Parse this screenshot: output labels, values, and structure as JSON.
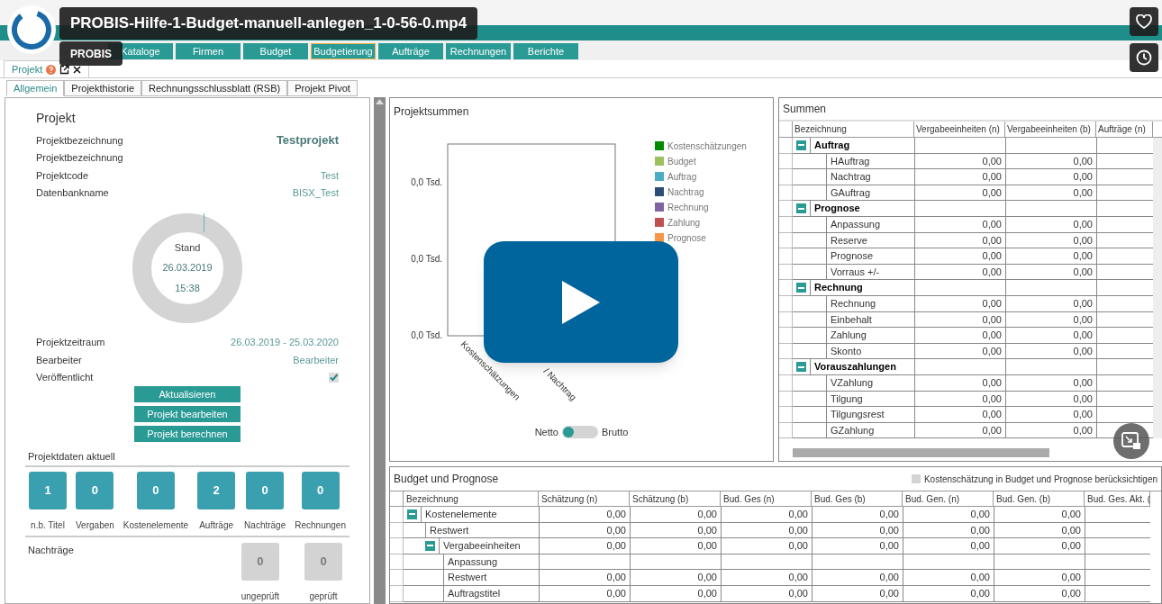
{
  "video": {
    "title": "PROBIS-Hilfe-1-Budget-manuell-anlegen_1-0-56-0.mp4",
    "channel": "PROBIS"
  },
  "nav_buttons": [
    {
      "label": "Kataloge",
      "selected": false
    },
    {
      "label": "Firmen",
      "selected": false
    },
    {
      "label": "Budget",
      "selected": false
    },
    {
      "label": "Budgetierung",
      "selected": true
    },
    {
      "label": "Aufträge",
      "selected": false
    },
    {
      "label": "Rechnungen",
      "selected": false
    },
    {
      "label": "Berichte",
      "selected": false
    }
  ],
  "document_tab": {
    "label": "Projekt"
  },
  "subtabs": [
    {
      "label": "Allgemein",
      "selected": true
    },
    {
      "label": "Projekthistorie",
      "selected": false
    },
    {
      "label": "Rechnungsschlussblatt (RSB)",
      "selected": false
    },
    {
      "label": "Projekt Pivot",
      "selected": false
    }
  ],
  "project": {
    "heading": "Projekt",
    "fields": [
      {
        "kind": "title",
        "label": "Projektbezeichnung",
        "value": "Testprojekt"
      },
      {
        "kind": "text",
        "label": "Projektbezeichnung"
      },
      {
        "kind": "value",
        "label": "Projektcode",
        "value": "Test"
      },
      {
        "kind": "value",
        "label": "Datenbankname",
        "value": "BISX_Test"
      }
    ],
    "status": {
      "label": "Stand",
      "date": "26.03.2019",
      "time": "15:38"
    },
    "fields_2": [
      {
        "kind": "value",
        "label": "Projektzeitraum",
        "value": "26.03.2019 - 25.03.2020"
      },
      {
        "kind": "value",
        "label": "Bearbeiter",
        "value": "Bearbeiter"
      },
      {
        "kind": "checkbox",
        "label": "Veröffentlicht",
        "checked": true
      }
    ],
    "buttons": [
      "Aktualisieren",
      "Projekt bearbeiten",
      "Projekt berechnen"
    ],
    "current": {
      "title": "Projektdaten aktuell",
      "tiles": [
        {
          "value": "1",
          "label": "n.b. Titel",
          "color": "#3a9fae"
        },
        {
          "value": "0",
          "label": "Vergaben",
          "color": "#3a9fae"
        },
        {
          "value": "0",
          "label": "Kostenelemente",
          "color": "#3a9fae"
        },
        {
          "value": "2",
          "label": "Aufträge",
          "color": "#3a9fae"
        },
        {
          "value": "0",
          "label": "Nachträge",
          "color": "#3a9fae"
        },
        {
          "value": "0",
          "label": "Rechnungen",
          "color": "#3a9fae"
        }
      ]
    },
    "supplements": {
      "title": "Nachträge",
      "tiles": [
        {
          "value": "0",
          "label": "ungeprüft",
          "color": "#d3d3d3"
        },
        {
          "value": "0",
          "label": "geprüft",
          "color": "#d3d3d3"
        }
      ]
    }
  },
  "chart": {
    "title": "Projektsummen",
    "y_labels": [
      "0,0 Tsd.",
      "0,0 Tsd.",
      "0,0 Tsd."
    ],
    "x_labels": [
      "Kostenschätzungen",
      "/ Nachtrag"
    ],
    "legend": [
      {
        "label": "Kostenschätzungen",
        "color": "#008a00"
      },
      {
        "label": "Budget",
        "color": "#9bc25c"
      },
      {
        "label": "Auftrag",
        "color": "#4bacc6"
      },
      {
        "label": "Nachtrag",
        "color": "#2c4d75"
      },
      {
        "label": "Rechnung",
        "color": "#8064a2"
      },
      {
        "label": "Zahlung",
        "color": "#c0504d"
      },
      {
        "label": "Prognose",
        "color": "#f79646"
      }
    ],
    "toggle": {
      "left": "Netto",
      "right": "Brutto",
      "on": false
    }
  },
  "summen": {
    "title": "Summen",
    "columns": [
      "Bezeichnung",
      "Vergabeeinheiten (n)",
      "Vergabeeinheiten (b)",
      "Aufträge (n)"
    ],
    "rows": [
      {
        "label": "Auftrag",
        "expanded": true,
        "children": [
          {
            "label": "HAuftrag",
            "values": [
              "0,00",
              "0,00"
            ]
          },
          {
            "label": "Nachtrag",
            "values": [
              "0,00",
              "0,00"
            ]
          },
          {
            "label": "GAuftrag",
            "values": [
              "0,00",
              "0,00"
            ]
          }
        ]
      },
      {
        "label": "Prognose",
        "expanded": true,
        "children": [
          {
            "label": "Anpassung",
            "values": [
              "0,00",
              "0,00"
            ]
          },
          {
            "label": "Reserve",
            "values": [
              "0,00",
              "0,00"
            ]
          },
          {
            "label": "Prognose",
            "values": [
              "0,00",
              "0,00"
            ]
          },
          {
            "label": "Vorraus +/-",
            "values": [
              "0,00",
              "0,00"
            ]
          }
        ]
      },
      {
        "label": "Rechnung",
        "expanded": true,
        "children": [
          {
            "label": "Rechnung",
            "values": [
              "0,00",
              "0,00"
            ]
          },
          {
            "label": "Einbehalt",
            "values": [
              "0,00",
              "0,00"
            ]
          },
          {
            "label": "Zahlung",
            "values": [
              "0,00",
              "0,00"
            ]
          },
          {
            "label": "Skonto",
            "values": [
              "0,00",
              "0,00"
            ]
          }
        ]
      },
      {
        "label": "Vorauszahlungen",
        "expanded": true,
        "children": [
          {
            "label": "VZahlung",
            "values": [
              "0,00",
              "0,00"
            ]
          },
          {
            "label": "Tilgung",
            "values": [
              "0,00",
              "0,00"
            ]
          },
          {
            "label": "Tilgungsrest",
            "values": [
              "0,00",
              "0,00"
            ]
          },
          {
            "label": "GZahlung",
            "values": [
              "0,00",
              "0,00"
            ]
          }
        ]
      }
    ]
  },
  "budget": {
    "title": "Budget und Prognose",
    "checkbox": {
      "label": "Kostenschätzung in Budget und Prognose berücksichtigen",
      "checked": false
    },
    "columns": [
      "Bezeichnung",
      "Schätzung (n)",
      "Schätzung (b)",
      "Bud. Ges (n)",
      "Bud. Ges (b)",
      "Bud. Gen. (n)",
      "Bud. Gen. (b)",
      "Bud. Ges. Akt. ("
    ],
    "rows": [
      {
        "label": "Kostenelemente",
        "expanded": true,
        "values": [
          "0,00",
          "0,00",
          "0,00",
          "0,00",
          "0,00",
          "0,00"
        ],
        "children": [
          {
            "label": "Restwert",
            "values": [
              "0,00",
              "0,00",
              "0,00",
              "0,00",
              "0,00",
              "0,00"
            ]
          },
          {
            "label": "Vergabeeinheiten",
            "expanded": true,
            "values": [
              "0,00",
              "0,00",
              "0,00",
              "0,00",
              "0,00",
              "0,00"
            ],
            "children": [
              {
                "label": "Anpassung"
              },
              {
                "label": "Restwert",
                "values": [
                  "0,00",
                  "0,00",
                  "0,00",
                  "0,00",
                  "0,00",
                  "0,00"
                ]
              },
              {
                "label": "Auftragstitel",
                "values": [
                  "0,00",
                  "0,00",
                  "0,00",
                  "0,00",
                  "0,00",
                  "0,00"
                ]
              }
            ]
          }
        ]
      }
    ]
  }
}
